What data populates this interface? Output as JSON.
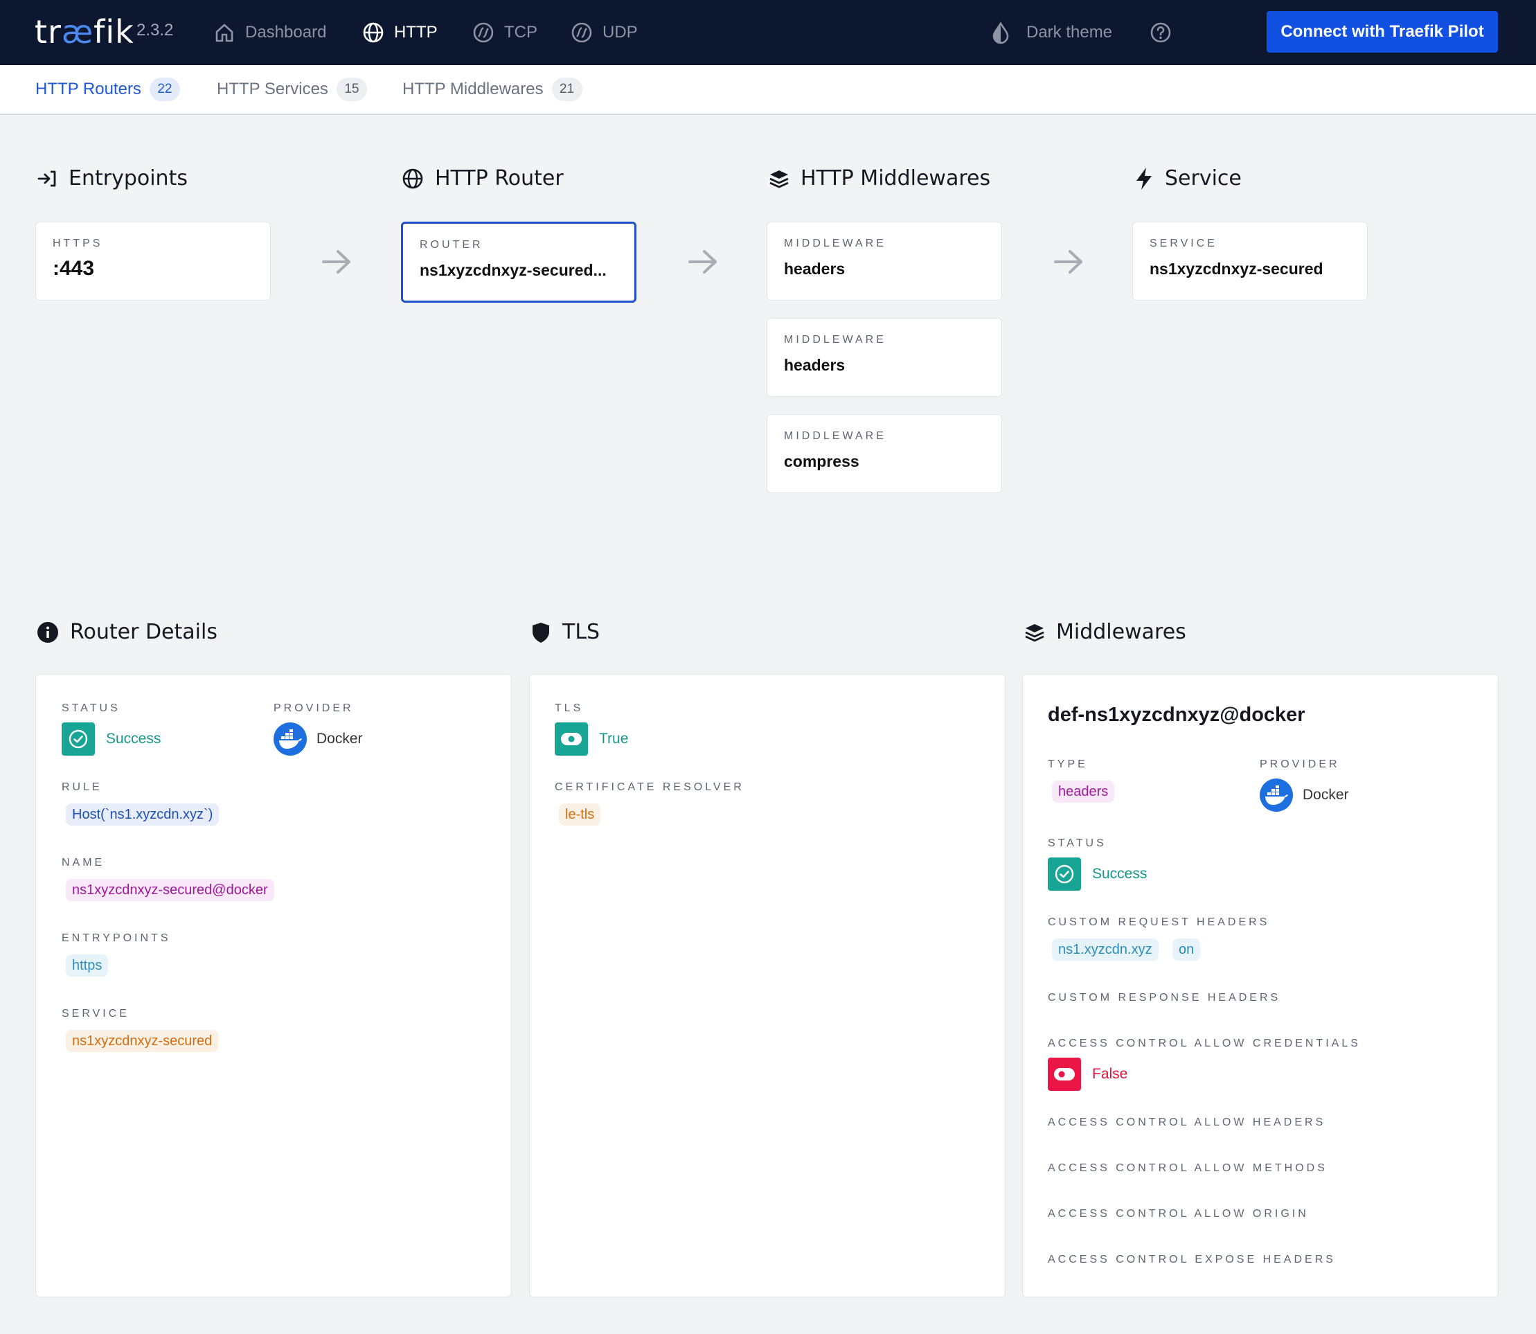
{
  "app": {
    "logo_pre": "tr",
    "logo_ae": "æ",
    "logo_post": "fik",
    "version": "2.3.2"
  },
  "nav": {
    "dashboard": "Dashboard",
    "http": "HTTP",
    "tcp": "TCP",
    "udp": "UDP",
    "dark_theme": "Dark theme",
    "pilot_button": "Connect with Traefik Pilot"
  },
  "tabs": [
    {
      "label": "HTTP Routers",
      "count": "22"
    },
    {
      "label": "HTTP Services",
      "count": "15"
    },
    {
      "label": "HTTP Middlewares",
      "count": "21"
    }
  ],
  "flow": {
    "entrypoints": {
      "title": "Entrypoints",
      "label": "HTTPS",
      "value": ":443"
    },
    "router": {
      "title": "HTTP Router",
      "label": "ROUTER",
      "value": "ns1xyzcdnxyz-secured..."
    },
    "middlewares": {
      "title": "HTTP Middlewares",
      "items": [
        {
          "label": "MIDDLEWARE",
          "value": "headers"
        },
        {
          "label": "MIDDLEWARE",
          "value": "headers"
        },
        {
          "label": "MIDDLEWARE",
          "value": "compress"
        }
      ]
    },
    "service": {
      "title": "Service",
      "label": "SERVICE",
      "value": "ns1xyzcdnxyz-secured"
    }
  },
  "router_details": {
    "title": "Router Details",
    "status_label": "STATUS",
    "status_value": "Success",
    "provider_label": "PROVIDER",
    "provider_value": "Docker",
    "rule_label": "RULE",
    "rule_value": "Host(`ns1.xyzcdn.xyz`)",
    "name_label": "NAME",
    "name_value": "ns1xyzcdnxyz-secured@docker",
    "entrypoints_label": "ENTRYPOINTS",
    "entrypoints_value": "https",
    "service_label": "SERVICE",
    "service_value": "ns1xyzcdnxyz-secured"
  },
  "tls": {
    "title": "TLS",
    "tls_label": "TLS",
    "tls_value": "True",
    "resolver_label": "CERTIFICATE RESOLVER",
    "resolver_value": "le-tls"
  },
  "middlewares_panel": {
    "title": "Middlewares",
    "name": "def-ns1xyzcdnxyz@docker",
    "type_label": "TYPE",
    "type_value": "headers",
    "provider_label": "PROVIDER",
    "provider_value": "Docker",
    "status_label": "STATUS",
    "status_value": "Success",
    "custom_request_headers_label": "CUSTOM REQUEST HEADERS",
    "custom_request_headers": [
      "ns1.xyzcdn.xyz",
      "on"
    ],
    "custom_response_headers_label": "CUSTOM RESPONSE HEADERS",
    "allow_credentials_label": "ACCESS CONTROL ALLOW CREDENTIALS",
    "allow_credentials_value": "False",
    "allow_headers_label": "ACCESS CONTROL ALLOW HEADERS",
    "allow_methods_label": "ACCESS CONTROL ALLOW METHODS",
    "allow_origin_label": "ACCESS CONTROL ALLOW ORIGIN",
    "expose_headers_label": "ACCESS CONTROL EXPOSE HEADERS"
  },
  "colors": {
    "nav_bg": "#0d1730",
    "accent": "#1150e0",
    "success": "#19a596",
    "danger": "#ea1746"
  },
  "icons": {
    "dashboard": "home-icon",
    "http": "globe-icon",
    "tcp": "network-icon",
    "udp": "network-icon",
    "theme": "drop-icon",
    "help": "help-icon",
    "entrypoints": "sign-in-icon",
    "service": "bolt-icon",
    "middlewares": "layers-icon",
    "router_details": "info-icon",
    "tls": "shield-icon",
    "provider": "docker-icon"
  }
}
